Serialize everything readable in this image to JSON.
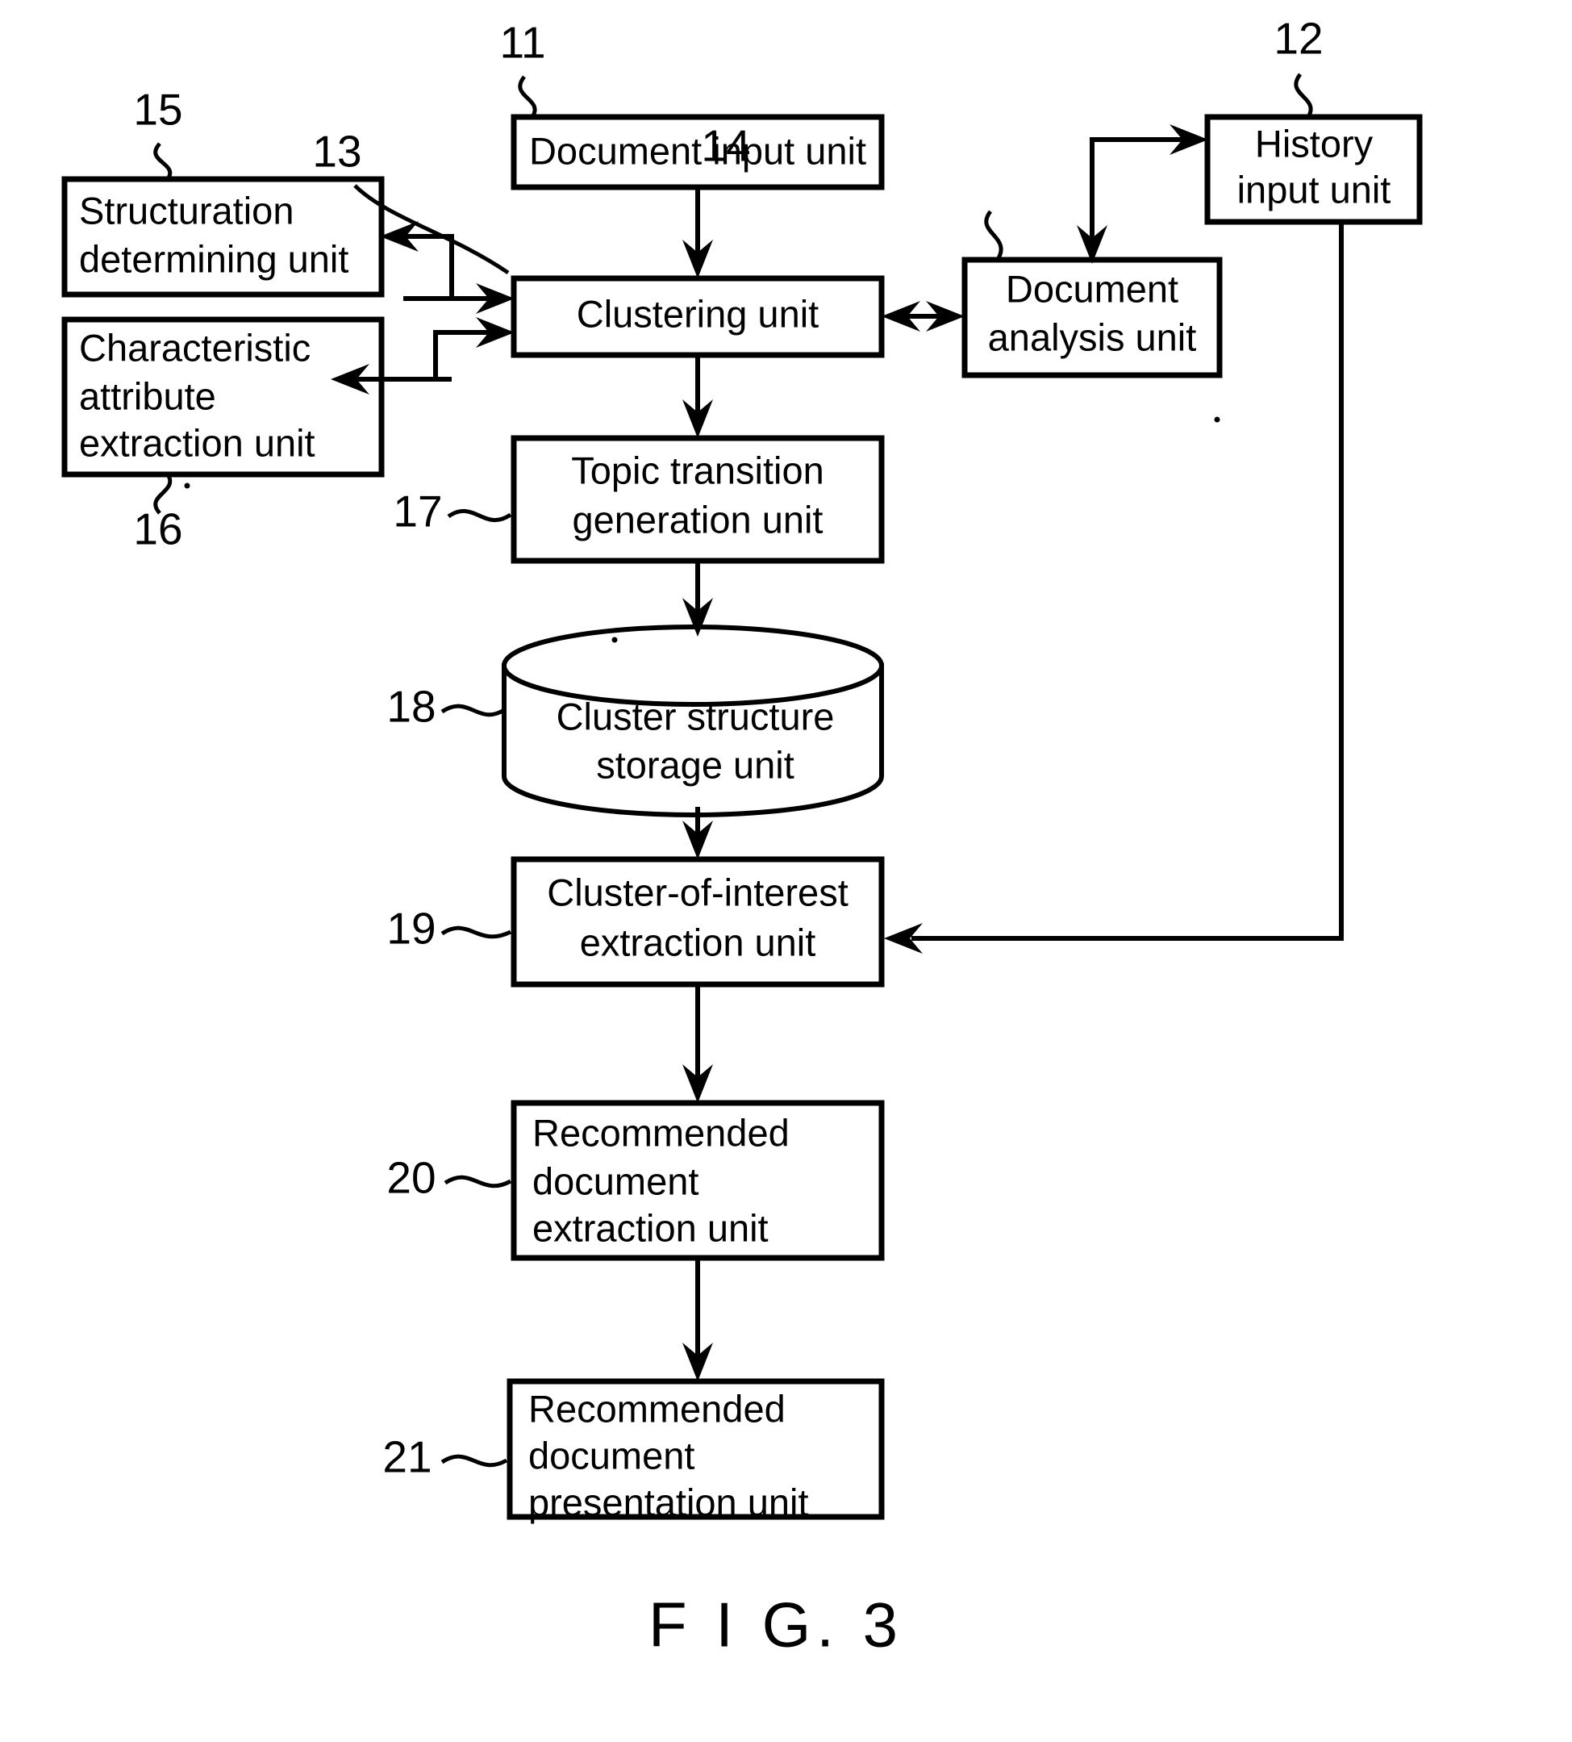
{
  "figure": {
    "caption": "F I G. 3",
    "type": "patent-block-diagram"
  },
  "blocks": {
    "document_input": {
      "ref": "11",
      "lines": [
        "Document input unit"
      ]
    },
    "history_input": {
      "ref": "12",
      "lines": [
        "History",
        "input unit"
      ]
    },
    "clustering": {
      "ref": "13",
      "lines": [
        "Clustering unit"
      ]
    },
    "document_analysis": {
      "ref": "14",
      "lines": [
        "Document",
        "analysis unit"
      ]
    },
    "structuration_determining": {
      "ref": "15",
      "lines": [
        "Structuration",
        "determining unit"
      ]
    },
    "characteristic_attribute": {
      "ref": "16",
      "lines": [
        "Characteristic",
        "attribute",
        "extraction unit"
      ]
    },
    "topic_transition": {
      "ref": "17",
      "lines": [
        "Topic transition",
        "generation unit"
      ]
    },
    "cluster_structure_storage": {
      "ref": "18",
      "lines": [
        "Cluster structure",
        "storage unit"
      ]
    },
    "cluster_of_interest": {
      "ref": "19",
      "lines": [
        "Cluster-of-interest",
        "extraction unit"
      ]
    },
    "recommended_document_extraction": {
      "ref": "20",
      "lines": [
        "Recommended",
        "document",
        "extraction unit"
      ]
    },
    "recommended_document_presentation": {
      "ref": "21",
      "lines": [
        "Recommended",
        "document",
        "presentation unit"
      ]
    }
  },
  "colors": {
    "ink": "#000000",
    "paper": "#ffffff"
  }
}
